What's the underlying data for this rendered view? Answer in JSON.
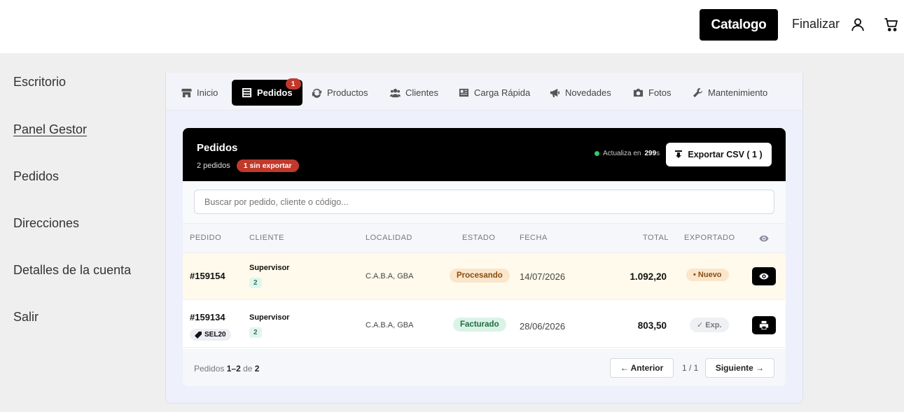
{
  "header": {
    "catalog_label": "Catalogo",
    "finalize_label": "Finalizar",
    "user_icon": "user-icon",
    "cart_icon": "cart-icon"
  },
  "sidebar": {
    "items": [
      {
        "label": "Escritorio"
      },
      {
        "label": "Panel Gestor",
        "active": true
      },
      {
        "label": "Pedidos"
      },
      {
        "label": "Direcciones"
      },
      {
        "label": "Detalles de la cuenta"
      },
      {
        "label": "Salir"
      }
    ]
  },
  "tabs": [
    {
      "label": "Inicio",
      "icon": "store-icon"
    },
    {
      "label": "Pedidos",
      "icon": "list-icon",
      "badge": "1",
      "active": true
    },
    {
      "label": "Productos",
      "icon": "sync-icon"
    },
    {
      "label": "Clientes",
      "icon": "users-icon"
    },
    {
      "label": "Carga Rápida",
      "icon": "newspaper-icon"
    },
    {
      "label": "Novedades",
      "icon": "megaphone-icon"
    },
    {
      "label": "Fotos",
      "icon": "camera-icon"
    },
    {
      "label": "Mantenimiento",
      "icon": "wrench-icon"
    }
  ],
  "orders_card": {
    "title": "Pedidos",
    "count_text": "2 pedidos",
    "unexported_badge": "1 sin exportar",
    "refresh_prefix": "Actualiza en",
    "refresh_seconds": "299",
    "refresh_suffix": "s",
    "export_label": "Exportar CSV ( 1 )",
    "search_placeholder": "Buscar por pedido, cliente o código...",
    "columns": [
      "Pedido",
      "Cliente",
      "Localidad",
      "Estado",
      "Fecha",
      "Total",
      "Exportado"
    ],
    "rows": [
      {
        "id": "#159154",
        "client": "Supervisor",
        "client_badge": "2",
        "location": "C.A.B.A, GBA",
        "status": "Procesando",
        "date": "14/07/2026",
        "total": "1.092,20",
        "exported": "• Nuevo",
        "action_icon": "eye-icon"
      },
      {
        "id": "#159134",
        "code": "SEL20",
        "client": "Supervisor",
        "client_badge": "2",
        "location": "C.A.B.A, GBA",
        "status": "Facturado",
        "date": "28/06/2026",
        "total": "803,50",
        "exported": "✓ Exp.",
        "action_icon": "print-icon"
      }
    ],
    "footer": {
      "label": "Pedidos",
      "range": "1–2",
      "of": "de",
      "total": "2",
      "prev_label": "← Anterior",
      "page": "1 / 1",
      "next_label": "Siguiente →"
    }
  }
}
